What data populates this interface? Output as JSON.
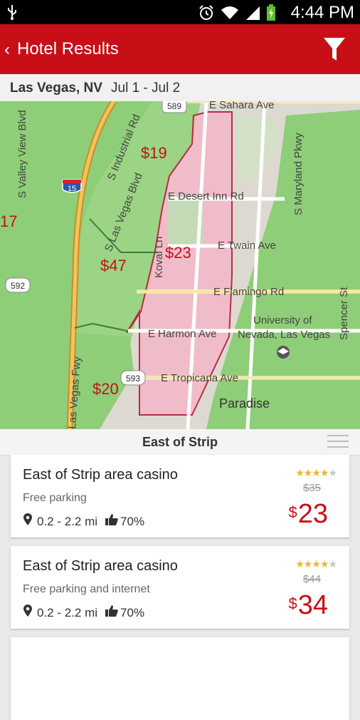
{
  "status_bar": {
    "time": "4:44 PM"
  },
  "header": {
    "back_label": "Hotel Results"
  },
  "search": {
    "city": "Las Vegas, NV",
    "dates": "Jul 1 - Jul 2"
  },
  "map": {
    "streets": {
      "sahara": "E Sahara Ave",
      "desert_inn": "E Desert Inn Rd",
      "twain": "E Twain Ave",
      "flamingo": "E Flamingo Rd",
      "harmon": "E Harmon Ave",
      "tropicana": "E Tropicana Ave",
      "valley_view": "S Valley View Blvd",
      "industrial": "S Industrial Rd",
      "las_vegas_blvd": "S Las Vegas Blvd",
      "koval": "Koval Ln",
      "maryland": "S Maryland Pkwy",
      "spencer": "Spencer St",
      "fwy": "Las Vegas Fwy"
    },
    "places": {
      "unlv_1": "University of",
      "unlv_2": "Nevada, Las Vegas",
      "paradise": "Paradise"
    },
    "shields": {
      "r589": "589",
      "i15": "15",
      "r592": "592",
      "r593": "593"
    },
    "zone_prices": {
      "p19": "$19",
      "p23": "$23",
      "p47": "$47",
      "p20": "$20",
      "p17": "17"
    }
  },
  "results": {
    "area_title": "East of Strip",
    "hotels": [
      {
        "name": "East of Strip area casino",
        "amenities": "Free parking",
        "distance": "0.2 - 2.2 mi",
        "rating_pct": "70%",
        "stars": 3.5,
        "old_price": "$35",
        "currency": "$",
        "price": "23"
      },
      {
        "name": "East of Strip area casino",
        "amenities": "Free parking and internet",
        "distance": "0.2 - 2.2 mi",
        "rating_pct": "70%",
        "stars": 4,
        "old_price": "$44",
        "currency": "$",
        "price": "34"
      }
    ]
  },
  "colors": {
    "accent": "#c80f17",
    "zone_green": "#8fce78",
    "zone_pink": "#f5b7c9",
    "star": "#f0b432"
  }
}
